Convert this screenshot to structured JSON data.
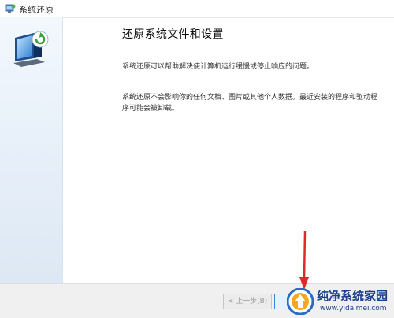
{
  "window": {
    "title": "系统还原",
    "icon": "system-restore-icon"
  },
  "sidebar": {
    "icon": "restore-computer-icon"
  },
  "content": {
    "heading": "还原系统文件和设置",
    "paragraph1": "系统还原可以帮助解决使计算机运行缓慢或停止响应的问题。",
    "paragraph2": "系统还原不会影响你的任何文档、图片或其他个人数据。最近安装的程序和驱动程序可能会被卸载。"
  },
  "buttons": {
    "back_label": "< 上一步(B)",
    "next_label": ""
  },
  "colors": {
    "arrow": "#e02a2a",
    "focus": "#3c83d8"
  },
  "watermark": {
    "name": "纯净系统家园",
    "url": "www.yidaimei.com"
  }
}
